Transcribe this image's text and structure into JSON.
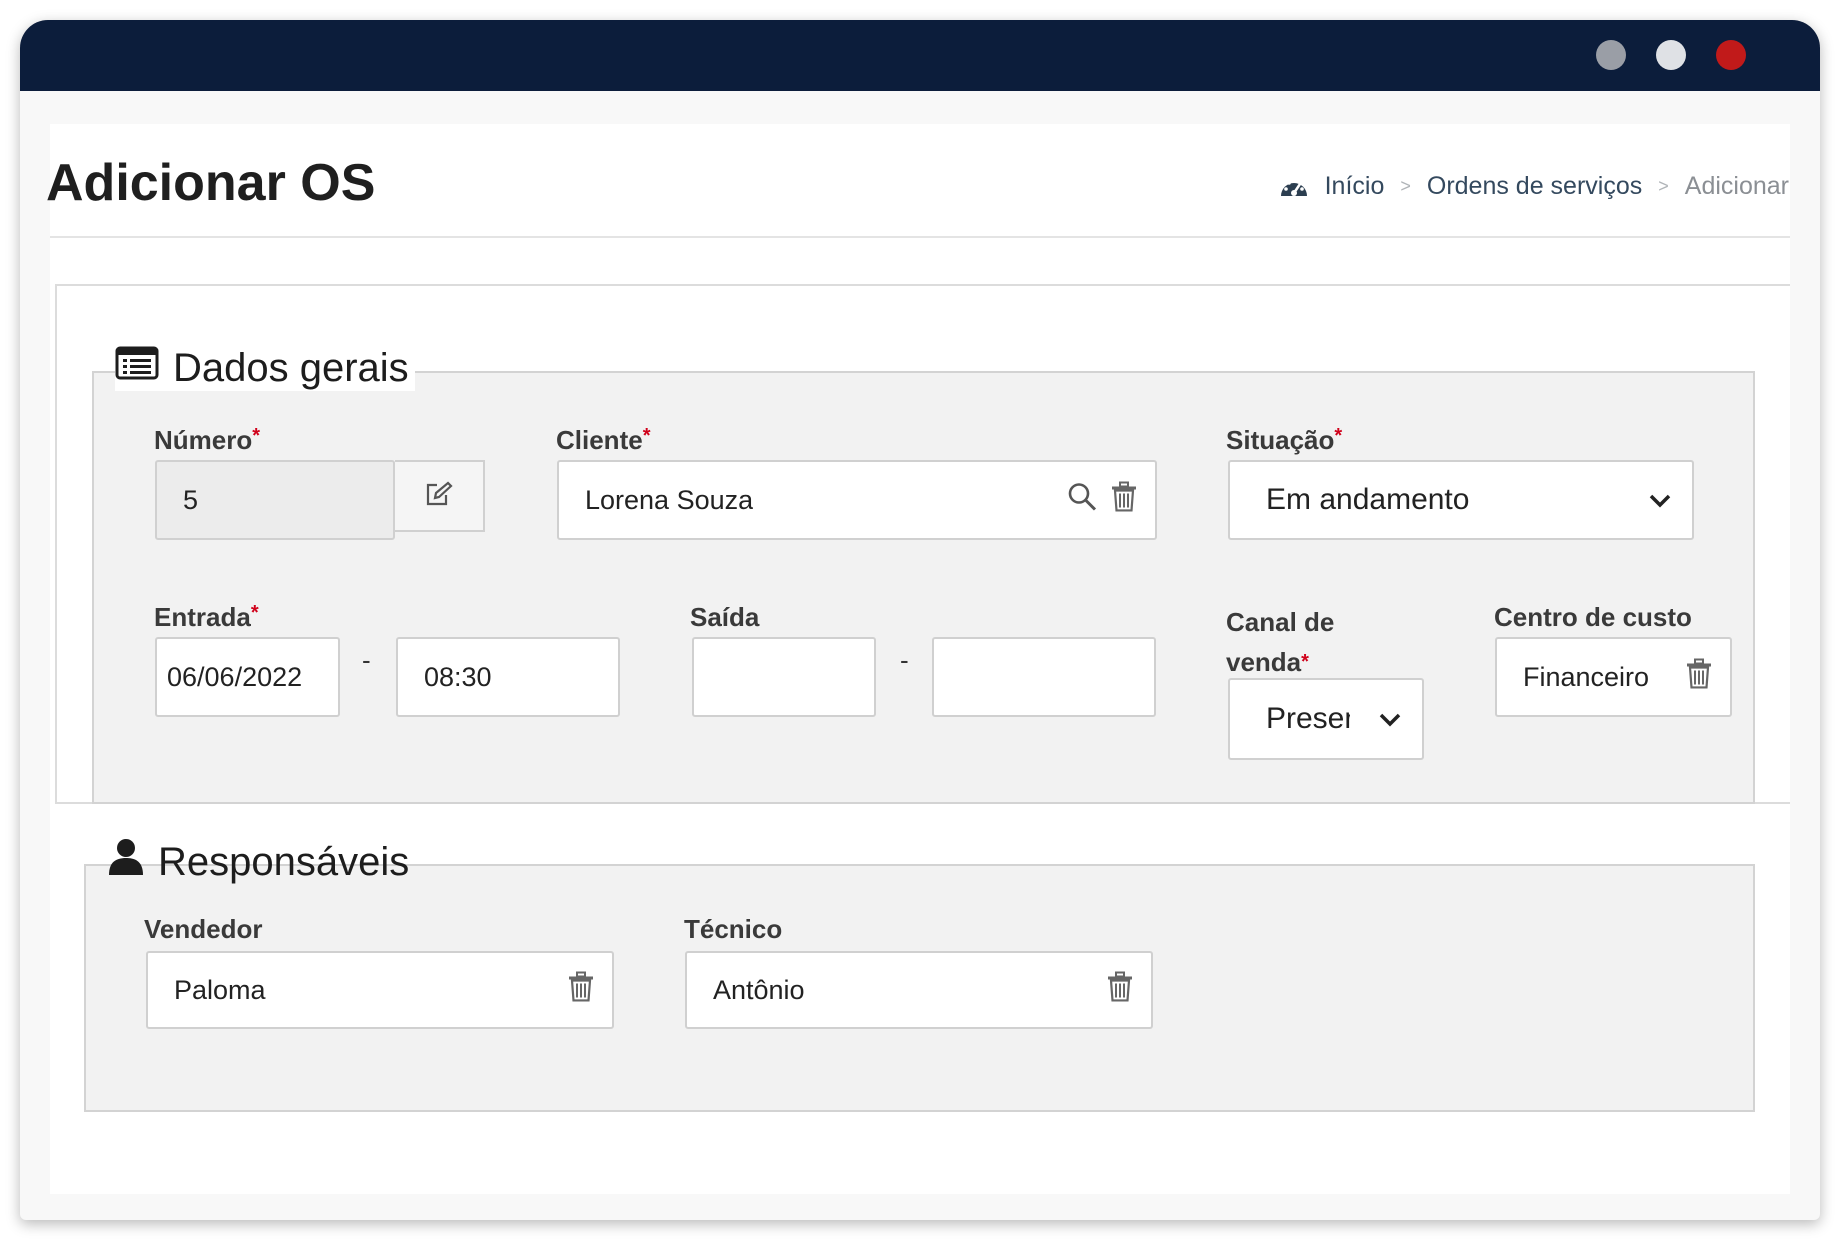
{
  "window": {
    "dots": [
      "#9a9ea6",
      "#dfe1e5",
      "#c11a1a"
    ]
  },
  "page": {
    "title": "Adicionar OS"
  },
  "breadcrumb": {
    "home": "Início",
    "section": "Ordens de serviços",
    "current": "Adicionar",
    "separator": ">"
  },
  "dados_gerais": {
    "legend": "Dados gerais",
    "required_mark": "*",
    "numero": {
      "label": "Número",
      "value": "5"
    },
    "cliente": {
      "label": "Cliente",
      "value": "Lorena Souza"
    },
    "situacao": {
      "label": "Situação",
      "value": "Em andamento"
    },
    "entrada": {
      "label": "Entrada",
      "date": "06/06/2022",
      "time": "08:30"
    },
    "saida": {
      "label": "Saída",
      "date": "",
      "time": ""
    },
    "range_separator": "-",
    "canal_venda": {
      "label_line1": "Canal de",
      "label_line2": "venda",
      "value": "Presencial"
    },
    "centro_custo": {
      "label": "Centro de custo",
      "value": "Financeiro"
    }
  },
  "responsaveis": {
    "legend": "Responsáveis",
    "vendedor": {
      "label": "Vendedor",
      "value": "Paloma"
    },
    "tecnico": {
      "label": "Técnico",
      "value": "Antônio"
    }
  },
  "icons": {
    "breadcrumb_home": "dashboard-icon",
    "legend1": "list-icon",
    "legend2": "user-icon",
    "edit": "edit-icon",
    "search": "search-icon",
    "delete": "trash-icon",
    "dropdown": "chevron-down-icon"
  }
}
